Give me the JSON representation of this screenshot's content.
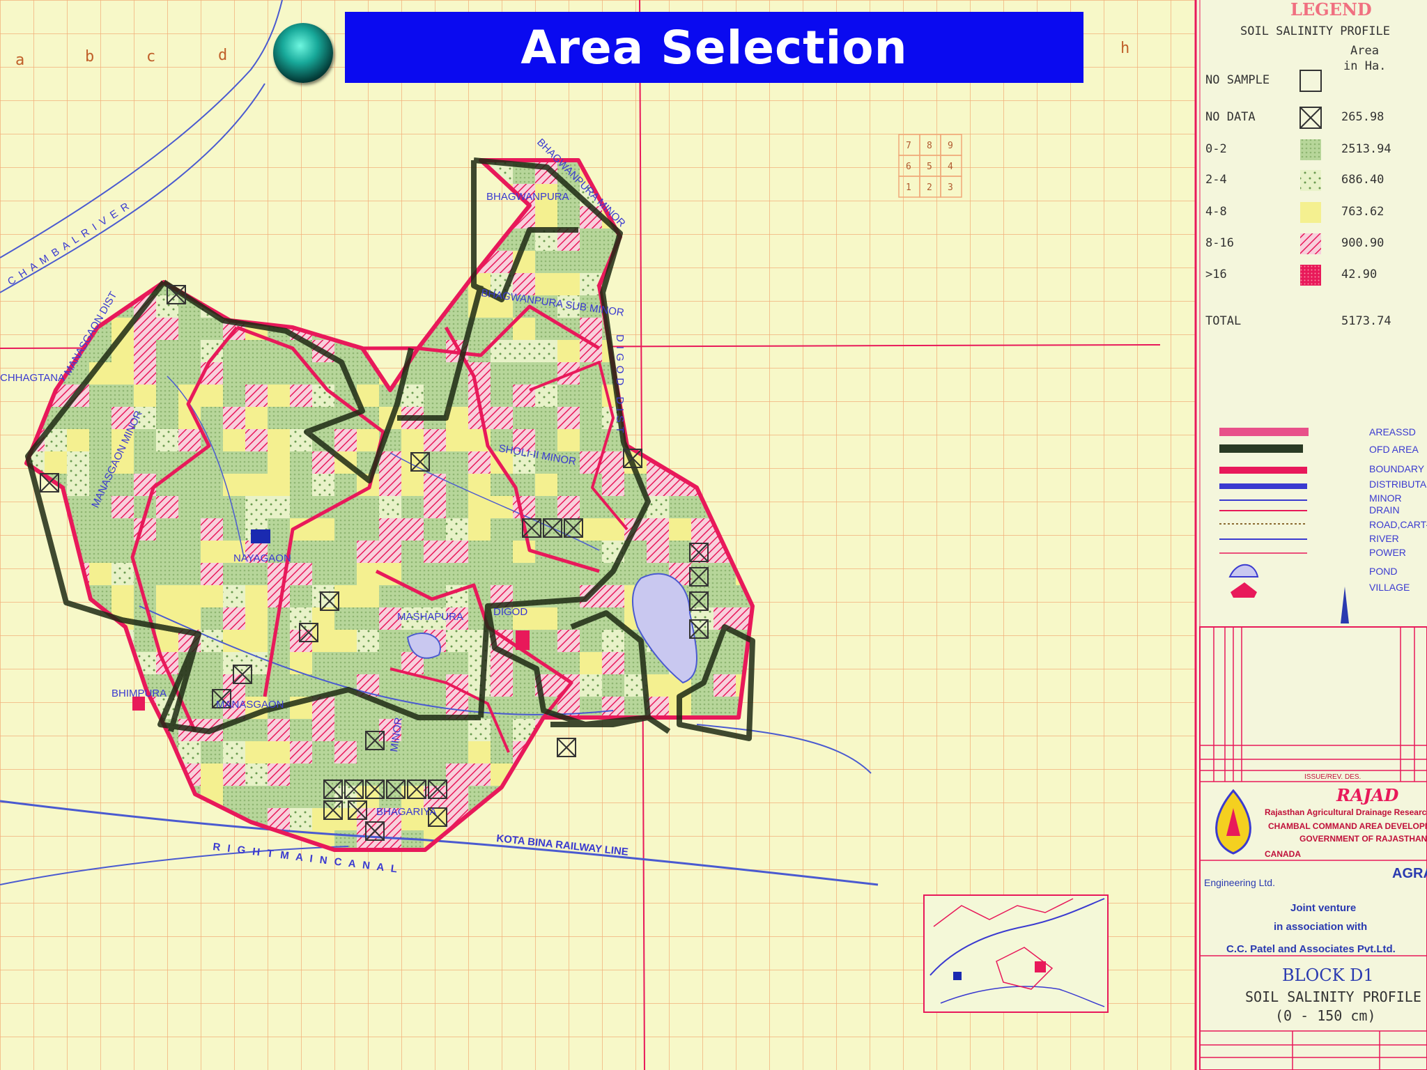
{
  "title": "Area Selection",
  "column_letters": [
    "a",
    "b",
    "c",
    "d",
    "h"
  ],
  "map_labels": {
    "river": "C H A M B A L   R I V E R",
    "canal": "R I G H T   M A I N   C A N A L",
    "railway": "KOTA BINA RAILWAY LINE",
    "villages": [
      "BHAGWANPURA",
      "NAYAGAON",
      "MASHAPURA",
      "DIGOD",
      "BHIMPURA",
      "CHHAGTANA",
      "MANASGAON",
      "BHAGARIYA"
    ],
    "minors": [
      "BHAGWANPURA MINOR",
      "BHAGWANPURA SUB MINOR",
      "SHOLI-II MINOR",
      "MANASGAON DIST",
      "MANASGAON MINOR",
      "DIGOD DIST",
      "MINOR"
    ]
  },
  "grid_key": [
    [
      "7",
      "8",
      "9"
    ],
    [
      "6",
      "5",
      "4"
    ],
    [
      "1",
      "2",
      "3"
    ]
  ],
  "legend": {
    "title": "LEGEND",
    "subtitle": "SOIL SALINITY PROFILE",
    "col_area": "Area",
    "col_unit": "in Ha.",
    "rows": [
      {
        "label": "NO SAMPLE",
        "area": "",
        "swatch": "empty"
      },
      {
        "label": "NO DATA",
        "area": "265.98",
        "swatch": "cross"
      },
      {
        "label": "0-2",
        "area": "2513.94",
        "swatch": "green"
      },
      {
        "label": "2-4",
        "area": "686.40",
        "swatch": "dots"
      },
      {
        "label": "4-8",
        "area": "763.62",
        "swatch": "yellow"
      },
      {
        "label": "8-16",
        "area": "900.90",
        "swatch": "hatch"
      },
      {
        "label": ">16",
        "area": "42.90",
        "swatch": "red"
      }
    ],
    "total_label": "TOTAL",
    "total_area": "5173.74",
    "line_keys": [
      "AREASSD",
      "OFD AREA",
      "BOUNDARY",
      "DISTRIBUTARY",
      "MINOR",
      "DRAIN",
      "ROAD,CART-TRACK",
      "RIVER",
      "POWER",
      "POND",
      "VILLAGE"
    ]
  },
  "title_block": {
    "rev_header": "ISSUE/REV. DES.",
    "org": "RAJAD",
    "org_line1": "Rajasthan Agricultural Drainage Research",
    "org_line2": "CHAMBAL COMMAND AREA DEVELOPMENT PROJECT",
    "org_line3": "GOVERNMENT OF RAJASTHAN",
    "country": "CANADA",
    "firm_left": "Engineering Ltd.",
    "firm_right": "AGRA",
    "jv1": "Joint venture",
    "jv2": "in association with",
    "jv3": "C.C. Patel and Associates Pvt.Ltd.",
    "block": "BLOCK D1",
    "profile": "SOIL SALINITY PROFILE",
    "depth": "(0 - 150 cm)"
  },
  "colors": {
    "title_bg": "#0a0af0",
    "boundary": "#e8195a",
    "ofd": "#1e2a14",
    "distributary": "#3a3ad0",
    "grid": "#f0a878"
  }
}
